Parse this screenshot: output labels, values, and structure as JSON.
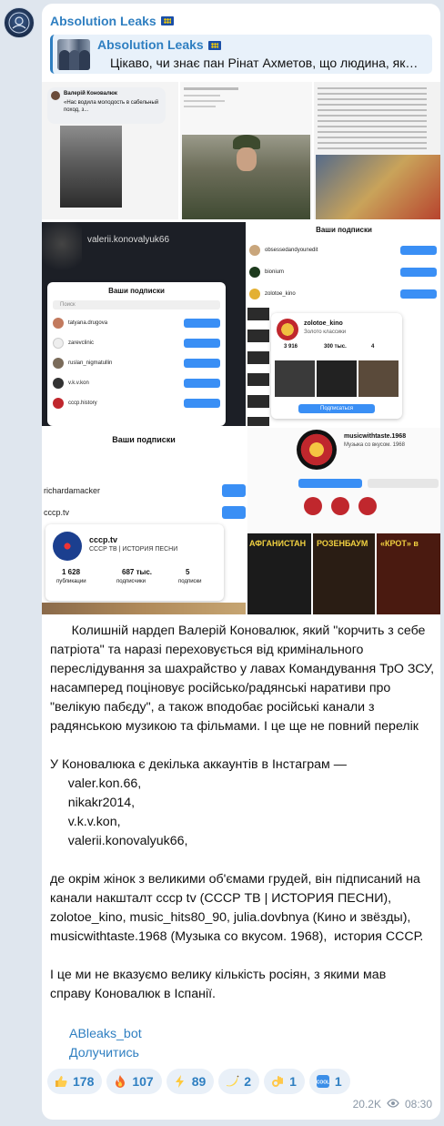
{
  "post": {
    "channel_name": "Absolution Leaks",
    "reply": {
      "title": "Absolution Leaks",
      "preview": "Цікаво, чи знає пан Рінат Ахметов, що людина, як…"
    },
    "body_lines": [
      "      Колишній нардеп Валерій Коновалюк, який \"корчить з себе",
      "патріота\" та наразі переховується від кримінального",
      "переслідування за шахрайство у лавах Командування ТрО ЗСУ,",
      "насамперед поціновує російсько/радянські наративи про",
      "\"велікую пабєду\", а також вподобає російські канали з",
      "радянською музикою та фільмами. І це ще не повний перелік",
      "",
      "У Коновалюка є декілька аккаунтів в Інстаграм —",
      "     valer.kon.66,",
      "     nikakr2014,",
      "     v.k.v.kon,",
      "     valerii.konovalyuk66,",
      "",
      "де окрім жінок з великими об'ємами грудей, він підписаний на",
      "канали накшталт cccp tv (СССР ТВ | ИСТОРИЯ ПЕСНИ),",
      "zolotoe_kino, music_hits80_90, julia.dovbnya (Кино и звёзды),",
      "musicwithtaste.1968 (Музыка со вкусом. 1968),  история СССР.",
      "",
      "І це ми не вказуємо велику кількість росіян, з якими мав",
      "справу Коновалюк в Іспанії."
    ],
    "bot_link": "ABleaks_bot",
    "join_link": "Долучитись",
    "reactions": [
      {
        "emoji": "thumbs-up",
        "count": "178"
      },
      {
        "emoji": "fire",
        "count": "107"
      },
      {
        "emoji": "lightning",
        "count": "89"
      },
      {
        "emoji": "banana",
        "count": "2"
      },
      {
        "emoji": "ok-hand",
        "count": "1"
      },
      {
        "emoji": "cool-button",
        "count": "1"
      }
    ],
    "views": "20.2K",
    "time": "08:30"
  },
  "gallery": {
    "t1_name": "Валерій Коновалюк",
    "t1_quote": "«Нас водила молодость в сабельный поход, з...",
    "t4_username": "valerii.konovalyuk66",
    "t4_sheet_title": "Ваши подписки",
    "t4_search": "Поиск",
    "t4_rows": [
      "tatyana.drugova",
      "zarevclinic",
      "ruslan_nigmatullin",
      "v.k.v.kon",
      "cccp.history"
    ],
    "follow_label": "Подписаться",
    "t5_title": "Ваши подписки",
    "t5_rows": [
      "obsessedandyounedit",
      "bionium",
      "zolotoe_kino"
    ],
    "t5_card_name": "zolotoe_kino",
    "t5_card_sub": "Золото классики",
    "t5_stats": [
      "3 916",
      "300 тыс.",
      "4"
    ],
    "t6_title": "Ваши подписки",
    "t6_rows": [
      "richardamacker",
      "cccp.tv"
    ],
    "t6_card_name": "cccp.tv",
    "t6_card_sub": "СССР ТВ | ИСТОРИЯ ПЕСНИ",
    "t6_stats": [
      "1 628",
      "687 тыс.",
      "5"
    ],
    "t6_stat_labels": [
      "публикации",
      "подписчики",
      "подписки"
    ],
    "t7_name": "musicwithtaste.1968",
    "t7_sub": "Музыка со вкусом. 1968",
    "t7_posters": [
      "АФГАНИСТАН",
      "РОЗЕНБАУМ",
      "«КРОТ» в"
    ]
  }
}
